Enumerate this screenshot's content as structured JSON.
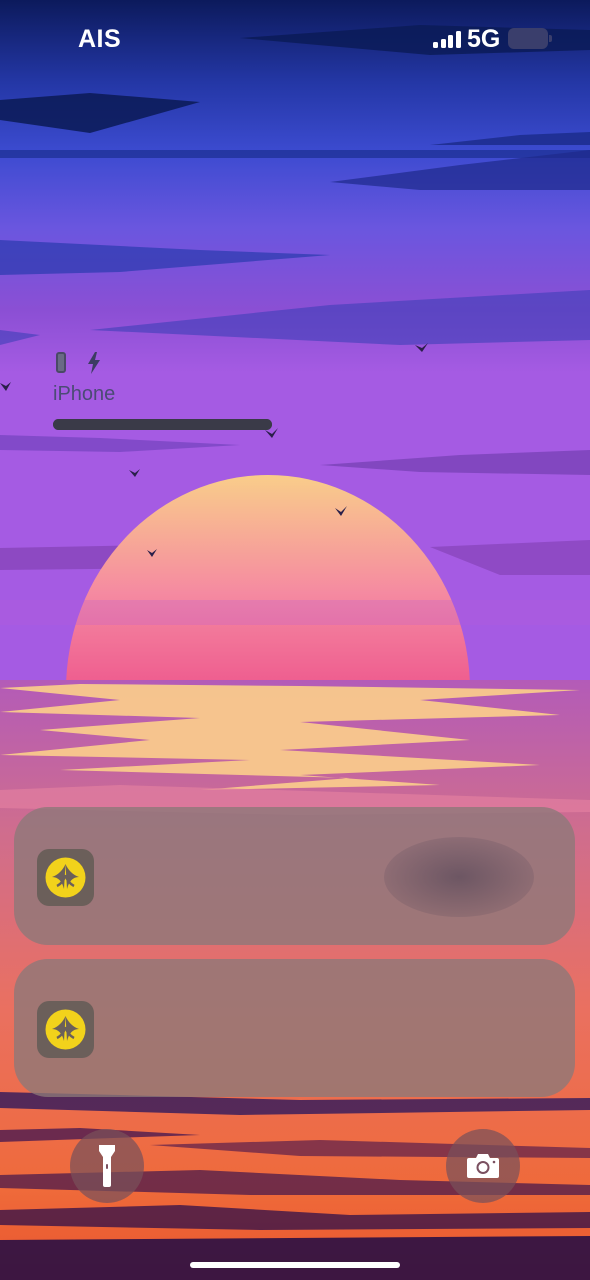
{
  "status_bar": {
    "carrier": "AIS",
    "network": "5G"
  },
  "battery_widget": {
    "device_name": "iPhone",
    "device_icon": "phone-icon",
    "charging_icon": "bolt-icon",
    "charge_level_percent": 100
  },
  "notifications": [
    {
      "app_icon": "bank-app-icon",
      "icon_color": "#f2d21b"
    },
    {
      "app_icon": "bank-app-icon",
      "icon_color": "#f2d21b"
    }
  ],
  "quick_actions": {
    "flashlight_icon": "flashlight-icon",
    "camera_icon": "camera-icon"
  },
  "colors": {
    "sky_top": "#0c1a5c",
    "sun_top": "#f9c98a",
    "sun_bottom": "#f4608f",
    "sea": "#f07248"
  }
}
